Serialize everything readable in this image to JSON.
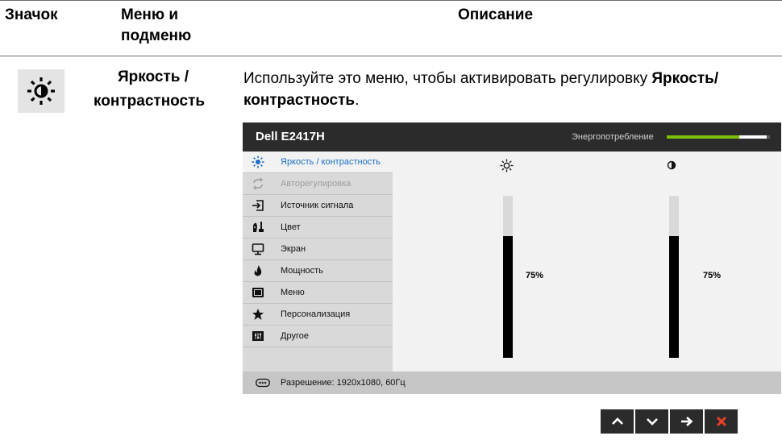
{
  "table": {
    "headers": {
      "icon": "Значок",
      "menu_line1": "Меню и",
      "menu_line2": "подменю",
      "description": "Описание"
    },
    "row": {
      "icon": "brightness-contrast-icon",
      "menu_line1": "Яркость /",
      "menu_line2": "контрастность",
      "desc_prefix": "Используйте это меню, чтобы активировать регулировку ",
      "desc_bold1": "Яркость/",
      "desc_bold2": "контрастность",
      "desc_suffix": "."
    }
  },
  "osd": {
    "model": "Dell E2417H",
    "energy_label": "Энергопотребление",
    "energy_level": 0.7,
    "menu": [
      {
        "label": "Яркость / контрастность",
        "icon": "brightness-icon",
        "state": "selected"
      },
      {
        "label": "Авторегулировка",
        "icon": "auto-adjust-icon",
        "state": "disabled"
      },
      {
        "label": "Источник сигнала",
        "icon": "input-source-icon",
        "state": "normal"
      },
      {
        "label": "Цвет",
        "icon": "color-icon",
        "state": "normal"
      },
      {
        "label": "Экран",
        "icon": "display-icon",
        "state": "normal"
      },
      {
        "label": "Мощность",
        "icon": "power-icon",
        "state": "normal"
      },
      {
        "label": "Меню",
        "icon": "menu-icon",
        "state": "normal"
      },
      {
        "label": "Персонализация",
        "icon": "star-icon",
        "state": "normal"
      },
      {
        "label": "Другое",
        "icon": "other-icon",
        "state": "normal"
      }
    ],
    "brightness": {
      "value": 75,
      "label": "75%"
    },
    "contrast": {
      "value": 75,
      "label": "75%"
    },
    "resolution": "Разрешение: 1920x1080, 60Гц",
    "nav_buttons": [
      "up-icon",
      "down-icon",
      "enter-arrow-icon",
      "exit-icon"
    ],
    "colors": {
      "accent": "#1a6ec8",
      "energy": "#7ac000",
      "exit": "#e8402a"
    }
  }
}
